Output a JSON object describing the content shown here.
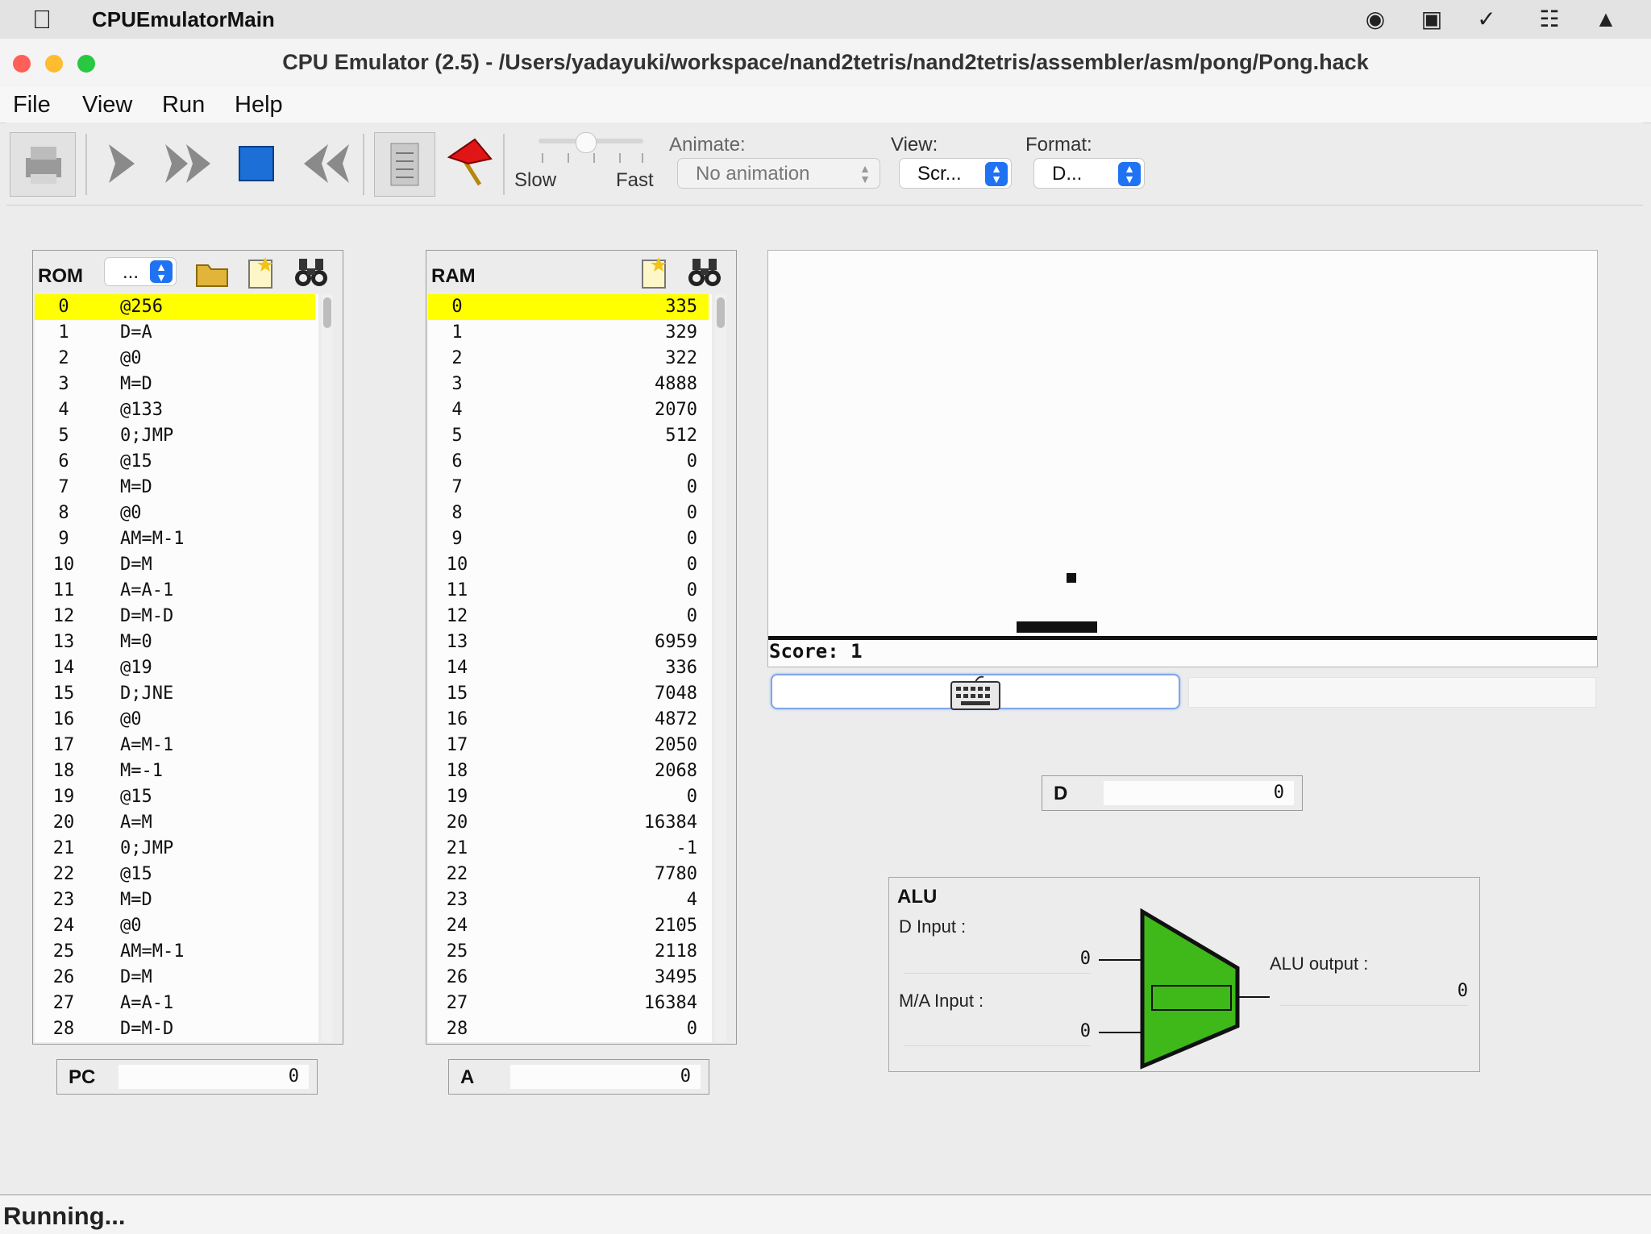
{
  "system_menubar": {
    "app_name": "CPUEmulatorMain"
  },
  "window": {
    "title": "CPU Emulator (2.5) - /Users/yadayuki/workspace/nand2tetris/nand2tetris/assembler/asm/pong/Pong.hack"
  },
  "menu": {
    "file": "File",
    "view": "View",
    "run": "Run",
    "help": "Help"
  },
  "toolbar": {
    "speed_slow": "Slow",
    "speed_fast": "Fast",
    "animate_label": "Animate:",
    "animate_value": "No animation",
    "view_label": "View:",
    "view_value": "Scr...",
    "format_label": "Format:",
    "format_value": "D..."
  },
  "rom": {
    "title": "ROM",
    "format_value": "...",
    "rows": [
      {
        "index": "0",
        "instruction": "@256"
      },
      {
        "index": "1",
        "instruction": "D=A"
      },
      {
        "index": "2",
        "instruction": "@0"
      },
      {
        "index": "3",
        "instruction": "M=D"
      },
      {
        "index": "4",
        "instruction": "@133"
      },
      {
        "index": "5",
        "instruction": "0;JMP"
      },
      {
        "index": "6",
        "instruction": "@15"
      },
      {
        "index": "7",
        "instruction": "M=D"
      },
      {
        "index": "8",
        "instruction": "@0"
      },
      {
        "index": "9",
        "instruction": "AM=M-1"
      },
      {
        "index": "10",
        "instruction": "D=M"
      },
      {
        "index": "11",
        "instruction": "A=A-1"
      },
      {
        "index": "12",
        "instruction": "D=M-D"
      },
      {
        "index": "13",
        "instruction": "M=0"
      },
      {
        "index": "14",
        "instruction": "@19"
      },
      {
        "index": "15",
        "instruction": "D;JNE"
      },
      {
        "index": "16",
        "instruction": "@0"
      },
      {
        "index": "17",
        "instruction": "A=M-1"
      },
      {
        "index": "18",
        "instruction": "M=-1"
      },
      {
        "index": "19",
        "instruction": "@15"
      },
      {
        "index": "20",
        "instruction": "A=M"
      },
      {
        "index": "21",
        "instruction": "0;JMP"
      },
      {
        "index": "22",
        "instruction": "@15"
      },
      {
        "index": "23",
        "instruction": "M=D"
      },
      {
        "index": "24",
        "instruction": "@0"
      },
      {
        "index": "25",
        "instruction": "AM=M-1"
      },
      {
        "index": "26",
        "instruction": "D=M"
      },
      {
        "index": "27",
        "instruction": "A=A-1"
      },
      {
        "index": "28",
        "instruction": "D=M-D"
      }
    ]
  },
  "ram": {
    "title": "RAM",
    "rows": [
      {
        "index": "0",
        "value": "335"
      },
      {
        "index": "1",
        "value": "329"
      },
      {
        "index": "2",
        "value": "322"
      },
      {
        "index": "3",
        "value": "4888"
      },
      {
        "index": "4",
        "value": "2070"
      },
      {
        "index": "5",
        "value": "512"
      },
      {
        "index": "6",
        "value": "0"
      },
      {
        "index": "7",
        "value": "0"
      },
      {
        "index": "8",
        "value": "0"
      },
      {
        "index": "9",
        "value": "0"
      },
      {
        "index": "10",
        "value": "0"
      },
      {
        "index": "11",
        "value": "0"
      },
      {
        "index": "12",
        "value": "0"
      },
      {
        "index": "13",
        "value": "6959"
      },
      {
        "index": "14",
        "value": "336"
      },
      {
        "index": "15",
        "value": "7048"
      },
      {
        "index": "16",
        "value": "4872"
      },
      {
        "index": "17",
        "value": "2050"
      },
      {
        "index": "18",
        "value": "2068"
      },
      {
        "index": "19",
        "value": "0"
      },
      {
        "index": "20",
        "value": "16384"
      },
      {
        "index": "21",
        "value": "-1"
      },
      {
        "index": "22",
        "value": "7780"
      },
      {
        "index": "23",
        "value": "4"
      },
      {
        "index": "24",
        "value": "2105"
      },
      {
        "index": "25",
        "value": "2118"
      },
      {
        "index": "26",
        "value": "3495"
      },
      {
        "index": "27",
        "value": "16384"
      },
      {
        "index": "28",
        "value": "0"
      }
    ]
  },
  "registers": {
    "pc_label": "PC",
    "pc_value": "0",
    "a_label": "A",
    "a_value": "0",
    "d_label": "D",
    "d_value": "0"
  },
  "screen": {
    "score_text": "Score: 1"
  },
  "alu": {
    "title": "ALU",
    "d_input_label": "D Input :",
    "d_input_value": "0",
    "ma_input_label": "M/A Input :",
    "ma_input_value": "0",
    "output_label": "ALU output :",
    "output_value": "0",
    "color": "#3fb81a"
  },
  "status": {
    "text": "Running..."
  },
  "colors": {
    "selection": "#ffff00",
    "accent": "#1f73f2"
  }
}
